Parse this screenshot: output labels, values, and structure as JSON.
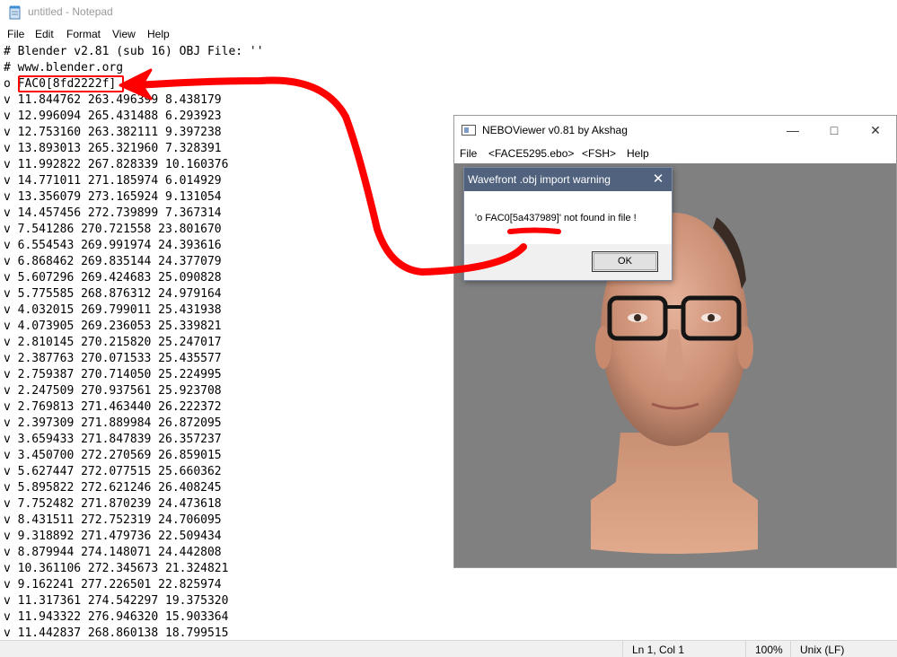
{
  "notepad": {
    "title": "untitled - Notepad",
    "menu": [
      "File",
      "Edit",
      "Format",
      "View",
      "Help"
    ],
    "lines": [
      "# Blender v2.81 (sub 16) OBJ File: ''",
      "# www.blender.org",
      "o FAC0[8fd2222f]",
      "v 11.844762 263.496399 8.438179",
      "v 12.996094 265.431488 6.293923",
      "v 12.753160 263.382111 9.397238",
      "v 13.893013 265.321960 7.328391",
      "v 11.992822 267.828339 10.160376",
      "v 14.771011 271.185974 6.014929",
      "v 13.356079 273.165924 9.131054",
      "v 14.457456 272.739899 7.367314",
      "v 7.541286 270.721558 23.801670",
      "v 6.554543 269.991974 24.393616",
      "v 6.868462 269.835144 24.377079",
      "v 5.607296 269.424683 25.090828",
      "v 5.775585 268.876312 24.979164",
      "v 4.032015 269.799011 25.431938",
      "v 4.073905 269.236053 25.339821",
      "v 2.810145 270.215820 25.247017",
      "v 2.387763 270.071533 25.435577",
      "v 2.759387 270.714050 25.224995",
      "v 2.247509 270.937561 25.923708",
      "v 2.769813 271.463440 26.222372",
      "v 2.397309 271.889984 26.872095",
      "v 3.659433 271.847839 26.357237",
      "v 3.450700 272.270569 26.859015",
      "v 5.627447 272.077515 25.660362",
      "v 5.895822 272.621246 26.408245",
      "v 7.752482 271.870239 24.473618",
      "v 8.431511 272.752319 24.706095",
      "v 9.318892 271.479736 22.509434",
      "v 8.879944 274.148071 24.442808",
      "v 10.361106 272.345673 21.324821",
      "v 9.162241 277.226501 22.825974",
      "v 11.317361 274.542297 19.375320",
      "v 11.943322 276.946320 15.903364",
      "v 11.442837 268.860138 18.799515"
    ],
    "status": {
      "position": "Ln 1, Col 1",
      "zoom": "100%",
      "line_ending": "Unix (LF)"
    }
  },
  "viewer": {
    "title": "NEBOViewer v0.81 by Akshag",
    "menu": [
      "File",
      "<FACE5295.ebo>",
      "<FSH>",
      "Help"
    ],
    "canvas_color": "#808080"
  },
  "dialog": {
    "title": "Wavefront .obj import warning",
    "message": "'o FAC0[5a437989]' not found in file !",
    "ok_label": "OK"
  },
  "annotation_color": "#ff0000"
}
